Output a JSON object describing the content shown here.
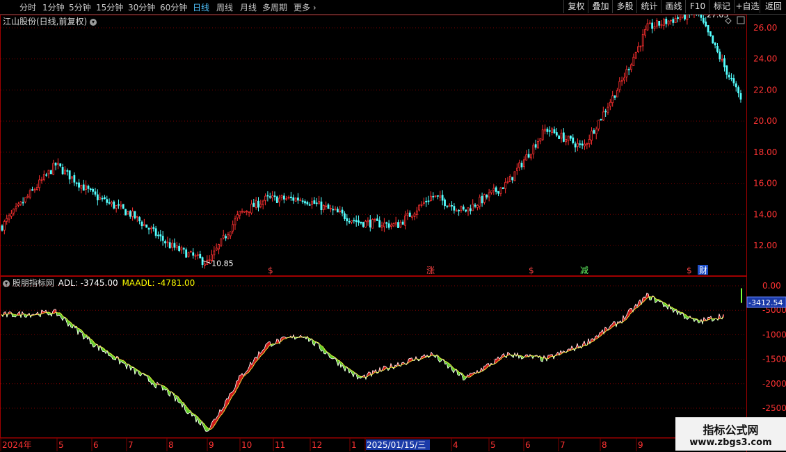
{
  "toolbar": {
    "timeframes": [
      "分时",
      "1分钟",
      "5分钟",
      "15分钟",
      "30分钟",
      "60分钟",
      "日线",
      "周线",
      "月线",
      "多周期",
      "更多"
    ],
    "active": "日线",
    "right_buttons": [
      "复权",
      "叠加",
      "多股",
      "统计",
      "画线",
      "F10",
      "标记",
      "+自选",
      "返回"
    ]
  },
  "main_chart": {
    "title": "江山股份(日线,前复权)",
    "price_ticks": [
      "26.00",
      "24.00",
      "22.00",
      "20.00",
      "18.00",
      "16.00",
      "14.00",
      "12.00"
    ],
    "max_label": "27.03",
    "min_label": "10.85",
    "event_markers": [
      "$",
      "涨",
      "$",
      "减",
      "$",
      "财"
    ]
  },
  "indicator": {
    "name": "股朋指标网",
    "adl": "ADL: -3745.00",
    "maadl": "MAADL: -4781.00",
    "ticks": [
      "0.00",
      "-5000",
      "-10000",
      "-15000",
      "-20000",
      "-25000"
    ],
    "current_value": "-3412.54"
  },
  "x_axis": {
    "labels": [
      "2024年",
      "5",
      "6",
      "7",
      "8",
      "9",
      "10",
      "11",
      "12",
      "1",
      "2025/01/15/三",
      "4",
      "5",
      "6",
      "7",
      "8",
      "9"
    ]
  },
  "chart_data": {
    "type": "line",
    "x": [
      "2024-04",
      "2024-05-15",
      "2024-06-15",
      "2024-07-15",
      "2024-08-15",
      "2024-09-15",
      "2024-10-10",
      "2024-11-01",
      "2024-12-01",
      "2025-01-15",
      "2025-02-15",
      "2025-03-15",
      "2025-04-10",
      "2025-05-15",
      "2025-06-15",
      "2025-07-15",
      "2025-08-15",
      "2025-09-05",
      "2025-10-15",
      "2025-11-20"
    ],
    "series": [
      {
        "values": [
          13.2,
          17.2,
          15.2,
          14.0,
          12.0,
          10.85,
          14.0,
          15.0,
          15.0,
          13.5,
          13.3,
          15.2,
          14.2,
          16.0,
          19.5,
          18.3,
          22.5,
          26.0,
          27.03,
          21.3
        ]
      },
      {
        "name": "ADL",
        "values": [
          -6000,
          -5500,
          -12000,
          -17000,
          -22000,
          -29500,
          -19000,
          -12000,
          -10000,
          -19000,
          -16000,
          -14000,
          -19000,
          -14000,
          -15000,
          -12000,
          -7000,
          -2000,
          -7500,
          -5000
        ]
      }
    ],
    "price_range": [
      11,
      27.03
    ],
    "adl_range": [
      -28000,
      500
    ],
    "grid": true
  }
}
